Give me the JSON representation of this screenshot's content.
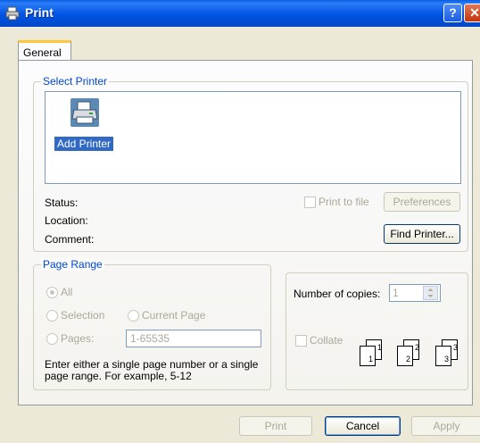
{
  "window": {
    "title": "Print"
  },
  "tabs": [
    {
      "label": "General"
    }
  ],
  "select_printer": {
    "group_label": "Select Printer",
    "printer_item": "Add Printer",
    "status_label": "Status:",
    "location_label": "Location:",
    "comment_label": "Comment:",
    "print_to_file_label": "Print to file",
    "preferences_label": "Preferences",
    "find_printer_label": "Find Printer..."
  },
  "page_range": {
    "group_label": "Page Range",
    "all_label": "All",
    "selection_label": "Selection",
    "current_page_label": "Current Page",
    "pages_label": "Pages:",
    "pages_value": "1-65535",
    "help_text_line1": "Enter either a single page number or a single",
    "help_text_line2": "page range.  For example, 5-12"
  },
  "copies": {
    "label": "Number of copies:",
    "value": "1",
    "collate_label": "Collate"
  },
  "footer": {
    "print_label": "Print",
    "cancel_label": "Cancel",
    "apply_label": "Apply"
  },
  "colors": {
    "title_bar": "#0054e3",
    "group_label": "#0046d5",
    "selection": "#316ac5",
    "dialog_face": "#ece9d8"
  },
  "icons": [
    "printer-icon",
    "help-icon",
    "close-icon",
    "spinner-icon",
    "collate-icon"
  ]
}
